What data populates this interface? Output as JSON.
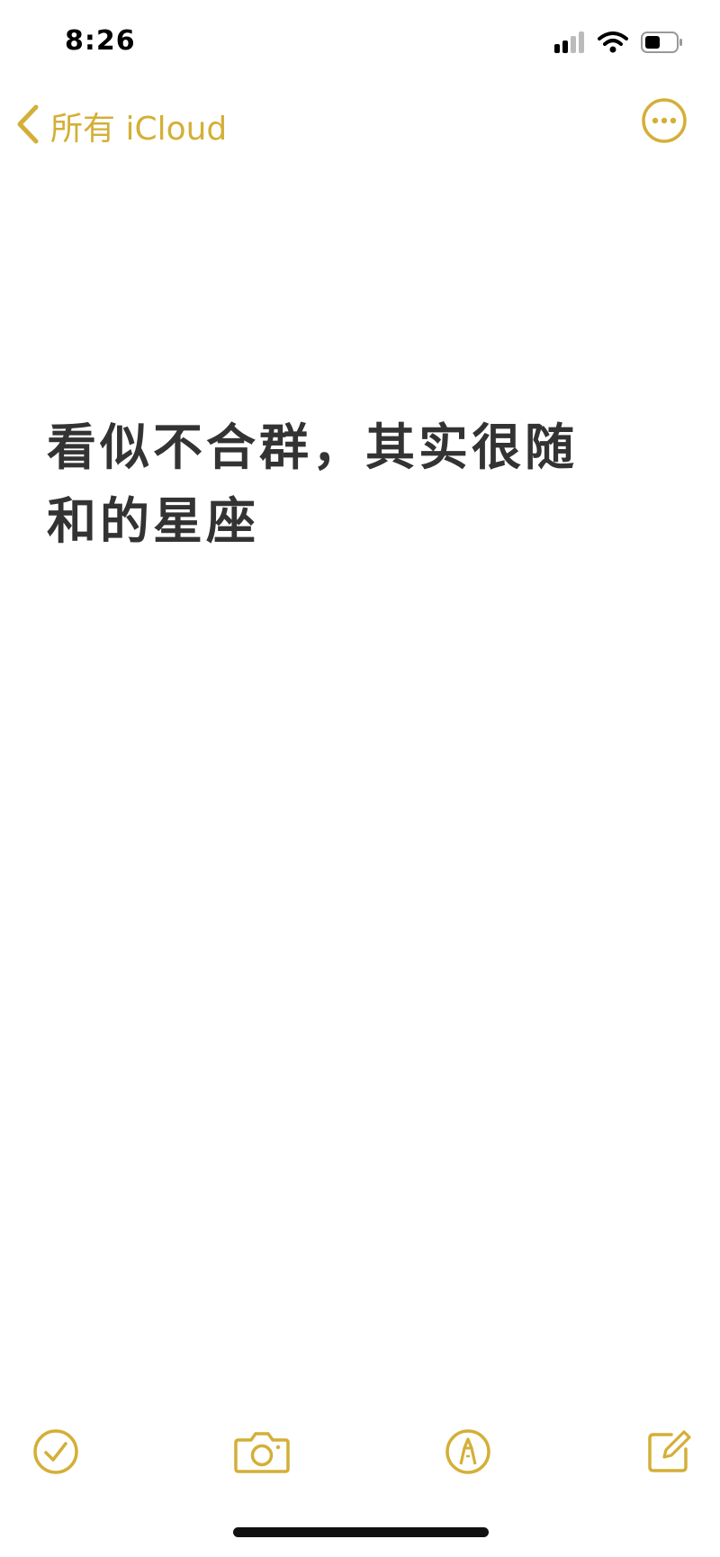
{
  "colors": {
    "accent": "#D4AF37",
    "text": "#333333"
  },
  "status_bar": {
    "time": "8:26",
    "icons": [
      "cellular-signal-icon",
      "wifi-icon",
      "battery-icon"
    ]
  },
  "nav": {
    "back_label": "所有 iCloud",
    "back_icon": "chevron-left-icon",
    "more_icon": "ellipsis-circle-icon"
  },
  "note": {
    "title_lines": [
      "看似不合群，其实很随",
      "和的星座"
    ]
  },
  "toolbar": {
    "items": [
      "checklist-icon",
      "camera-icon",
      "markup-pen-icon",
      "compose-icon"
    ]
  }
}
